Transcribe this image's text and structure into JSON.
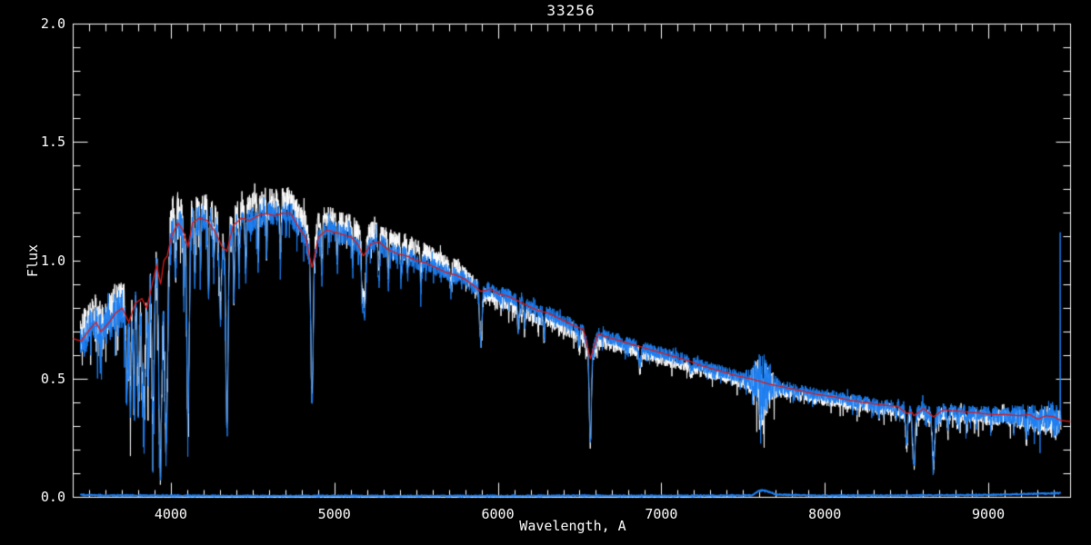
{
  "window": {
    "background": "#000000",
    "foreground": "#ffffff"
  },
  "chart_data": {
    "type": "line",
    "title": "33256",
    "xlabel": "Wavelength, A",
    "ylabel": "Flux",
    "xlim": [
      3400,
      9500
    ],
    "ylim": [
      0.0,
      2.0
    ],
    "grid": false,
    "legend": null,
    "x_major_ticks": [
      {
        "value": 4000,
        "label": "4000"
      },
      {
        "value": 5000,
        "label": "5000"
      },
      {
        "value": 6000,
        "label": "6000"
      },
      {
        "value": 7000,
        "label": "7000"
      },
      {
        "value": 8000,
        "label": "8000"
      },
      {
        "value": 9000,
        "label": "9000"
      }
    ],
    "x_minor_tick_step": 100,
    "y_major_ticks": [
      {
        "value": 0.0,
        "label": "0.0"
      },
      {
        "value": 0.5,
        "label": "0.5"
      },
      {
        "value": 1.0,
        "label": "1.0"
      },
      {
        "value": 1.5,
        "label": "1.5"
      },
      {
        "value": 2.0,
        "label": "2.0"
      }
    ],
    "y_minor_tick_step": 0.1,
    "colors": {
      "observed": "#1d7ff2",
      "uncorrected": "#ffffff",
      "model": "#dc1a1a",
      "axis": "#ffffff"
    },
    "series": [
      {
        "name": "observed-spectrum",
        "color": "#1d7ff2",
        "role": "noisy observed flux",
        "x_range": [
          3444,
          9443
        ]
      },
      {
        "name": "uncorrected-spectrum",
        "color": "#ffffff",
        "role": "companion trace, above observed blueward of ~5850 A, below redward",
        "x_range": [
          3444,
          9443
        ]
      },
      {
        "name": "model-fit",
        "color": "#dc1a1a",
        "role": "smooth template fit",
        "x_range": [
          3400,
          9500
        ]
      },
      {
        "name": "error-spectrum",
        "color": "#1d7ff2",
        "role": "uncertainty plotted near zero flux",
        "x_range": [
          3444,
          9443
        ]
      }
    ],
    "model_nodes": [
      [
        3400,
        0.67
      ],
      [
        3450,
        0.66
      ],
      [
        3500,
        0.71
      ],
      [
        3540,
        0.74
      ],
      [
        3570,
        0.7
      ],
      [
        3620,
        0.74
      ],
      [
        3660,
        0.78
      ],
      [
        3700,
        0.8
      ],
      [
        3740,
        0.74
      ],
      [
        3780,
        0.82
      ],
      [
        3820,
        0.84
      ],
      [
        3850,
        0.8
      ],
      [
        3880,
        0.89
      ],
      [
        3910,
        0.98
      ],
      [
        3935,
        0.9
      ],
      [
        3955,
        1.0
      ],
      [
        3975,
        1.02
      ],
      [
        4000,
        1.1
      ],
      [
        4040,
        1.16
      ],
      [
        4070,
        1.13
      ],
      [
        4102,
        1.06
      ],
      [
        4130,
        1.16
      ],
      [
        4170,
        1.18
      ],
      [
        4220,
        1.17
      ],
      [
        4270,
        1.12
      ],
      [
        4310,
        1.06
      ],
      [
        4340,
        1.04
      ],
      [
        4380,
        1.15
      ],
      [
        4430,
        1.18
      ],
      [
        4480,
        1.17
      ],
      [
        4530,
        1.19
      ],
      [
        4580,
        1.2
      ],
      [
        4630,
        1.19
      ],
      [
        4680,
        1.2
      ],
      [
        4730,
        1.2
      ],
      [
        4780,
        1.14
      ],
      [
        4820,
        1.1
      ],
      [
        4861,
        0.97
      ],
      [
        4900,
        1.1
      ],
      [
        4950,
        1.13
      ],
      [
        5000,
        1.12
      ],
      [
        5050,
        1.11
      ],
      [
        5100,
        1.1
      ],
      [
        5140,
        1.07
      ],
      [
        5175,
        1.02
      ],
      [
        5220,
        1.07
      ],
      [
        5270,
        1.08
      ],
      [
        5320,
        1.05
      ],
      [
        5380,
        1.03
      ],
      [
        5440,
        1.02
      ],
      [
        5500,
        1.0
      ],
      [
        5560,
        0.99
      ],
      [
        5620,
        0.97
      ],
      [
        5680,
        0.95
      ],
      [
        5740,
        0.94
      ],
      [
        5800,
        0.92
      ],
      [
        5860,
        0.89
      ],
      [
        5893,
        0.87
      ],
      [
        5950,
        0.88
      ],
      [
        6000,
        0.86
      ],
      [
        6060,
        0.85
      ],
      [
        6120,
        0.83
      ],
      [
        6180,
        0.81
      ],
      [
        6240,
        0.79
      ],
      [
        6300,
        0.78
      ],
      [
        6360,
        0.76
      ],
      [
        6420,
        0.74
      ],
      [
        6480,
        0.72
      ],
      [
        6520,
        0.71
      ],
      [
        6563,
        0.585
      ],
      [
        6610,
        0.69
      ],
      [
        6680,
        0.675
      ],
      [
        6750,
        0.66
      ],
      [
        6850,
        0.64
      ],
      [
        6950,
        0.62
      ],
      [
        7050,
        0.6
      ],
      [
        7150,
        0.58
      ],
      [
        7250,
        0.555
      ],
      [
        7350,
        0.535
      ],
      [
        7450,
        0.515
      ],
      [
        7550,
        0.5
      ],
      [
        7650,
        0.48
      ],
      [
        7750,
        0.465
      ],
      [
        7850,
        0.45
      ],
      [
        7950,
        0.435
      ],
      [
        8050,
        0.425
      ],
      [
        8150,
        0.41
      ],
      [
        8250,
        0.4
      ],
      [
        8350,
        0.39
      ],
      [
        8440,
        0.385
      ],
      [
        8498,
        0.355
      ],
      [
        8530,
        0.36
      ],
      [
        8542,
        0.345
      ],
      [
        8600,
        0.375
      ],
      [
        8662,
        0.34
      ],
      [
        8720,
        0.37
      ],
      [
        8800,
        0.365
      ],
      [
        8880,
        0.36
      ],
      [
        8950,
        0.355
      ],
      [
        9020,
        0.35
      ],
      [
        9100,
        0.35
      ],
      [
        9180,
        0.345
      ],
      [
        9250,
        0.35
      ],
      [
        9300,
        0.33
      ],
      [
        9350,
        0.345
      ],
      [
        9400,
        0.34
      ],
      [
        9440,
        0.325
      ],
      [
        9500,
        0.32
      ]
    ],
    "absorption_lines": [
      [
        3727,
        0.4,
        6
      ],
      [
        3750,
        0.45,
        5
      ],
      [
        3771,
        0.48,
        5
      ],
      [
        3798,
        0.52,
        6
      ],
      [
        3820,
        0.4,
        4
      ],
      [
        3835,
        0.58,
        7
      ],
      [
        3860,
        0.35,
        4
      ],
      [
        3889,
        0.62,
        7
      ],
      [
        3933,
        0.85,
        9
      ],
      [
        3968,
        0.82,
        9
      ],
      [
        4026,
        0.22,
        4
      ],
      [
        4077,
        0.25,
        3
      ],
      [
        4102,
        0.72,
        7
      ],
      [
        4144,
        0.22,
        4
      ],
      [
        4178,
        0.2,
        3
      ],
      [
        4227,
        0.28,
        4
      ],
      [
        4260,
        0.18,
        3
      ],
      [
        4300,
        0.3,
        7
      ],
      [
        4340,
        0.68,
        7
      ],
      [
        4383,
        0.3,
        4
      ],
      [
        4415,
        0.2,
        4
      ],
      [
        4455,
        0.2,
        4
      ],
      [
        4531,
        0.18,
        4
      ],
      [
        4584,
        0.15,
        3
      ],
      [
        4668,
        0.18,
        4
      ],
      [
        4861,
        0.58,
        7
      ],
      [
        4921,
        0.16,
        4
      ],
      [
        5015,
        0.14,
        4
      ],
      [
        5110,
        0.12,
        3
      ],
      [
        5169,
        0.22,
        5
      ],
      [
        5183,
        0.24,
        6
      ],
      [
        5270,
        0.18,
        5
      ],
      [
        5328,
        0.14,
        4
      ],
      [
        5406,
        0.12,
        4
      ],
      [
        5446,
        0.1,
        3
      ],
      [
        5528,
        0.12,
        4
      ],
      [
        5711,
        0.09,
        4
      ],
      [
        5893,
        0.24,
        7
      ],
      [
        6122,
        0.12,
        4
      ],
      [
        6162,
        0.11,
        4
      ],
      [
        6280,
        0.1,
        4
      ],
      [
        6495,
        0.09,
        4
      ],
      [
        6563,
        0.6,
        6
      ],
      [
        6867,
        0.12,
        7
      ],
      [
        7180,
        0.07,
        6
      ],
      [
        7605,
        0.05,
        8
      ],
      [
        8327,
        0.08,
        4
      ],
      [
        8434,
        0.1,
        4
      ],
      [
        8498,
        0.38,
        5
      ],
      [
        8542,
        0.6,
        7
      ],
      [
        8662,
        0.58,
        7
      ],
      [
        8750,
        0.18,
        5
      ],
      [
        8806,
        0.12,
        4
      ],
      [
        8865,
        0.15,
        5
      ],
      [
        9015,
        0.12,
        5
      ],
      [
        9229,
        0.2,
        5
      ],
      [
        9406,
        0.1,
        4
      ]
    ],
    "noise_nodes": [
      [
        3400,
        0.08
      ],
      [
        3600,
        0.085
      ],
      [
        3800,
        0.09
      ],
      [
        4000,
        0.075
      ],
      [
        4200,
        0.06
      ],
      [
        4400,
        0.055
      ],
      [
        4600,
        0.05
      ],
      [
        4800,
        0.05
      ],
      [
        5000,
        0.045
      ],
      [
        5200,
        0.04
      ],
      [
        5500,
        0.038
      ],
      [
        5800,
        0.035
      ],
      [
        6100,
        0.032
      ],
      [
        6400,
        0.03
      ],
      [
        6700,
        0.028
      ],
      [
        7000,
        0.027
      ],
      [
        7300,
        0.026
      ],
      [
        7600,
        0.028
      ],
      [
        7900,
        0.026
      ],
      [
        8200,
        0.028
      ],
      [
        8500,
        0.03
      ],
      [
        8800,
        0.032
      ],
      [
        9000,
        0.035
      ],
      [
        9200,
        0.045
      ],
      [
        9350,
        0.06
      ],
      [
        9440,
        0.065
      ]
    ],
    "telluric_band": {
      "center": 7615,
      "sigma": 40,
      "extra_amplitude": 0.13
    },
    "white_scale": {
      "below": 1.05,
      "above": 0.958,
      "crossover": 5850,
      "softness": 80
    },
    "error_nodes": [
      [
        3444,
        0.01
      ],
      [
        3600,
        0.008
      ],
      [
        3800,
        0.008
      ],
      [
        4000,
        0.007
      ],
      [
        4500,
        0.006
      ],
      [
        5000,
        0.006
      ],
      [
        5500,
        0.006
      ],
      [
        6000,
        0.006
      ],
      [
        6500,
        0.007
      ],
      [
        7000,
        0.006
      ],
      [
        7550,
        0.008
      ],
      [
        7590,
        0.025
      ],
      [
        7615,
        0.03
      ],
      [
        7660,
        0.022
      ],
      [
        7700,
        0.012
      ],
      [
        7800,
        0.01
      ],
      [
        8000,
        0.007
      ],
      [
        8500,
        0.008
      ],
      [
        9000,
        0.01
      ],
      [
        9200,
        0.014
      ],
      [
        9350,
        0.016
      ],
      [
        9443,
        0.018
      ]
    ],
    "edge_spike": {
      "wavelength": 9437,
      "flux_top": 1.12
    },
    "sample_step": 1.5,
    "noise_seed": 1337
  }
}
